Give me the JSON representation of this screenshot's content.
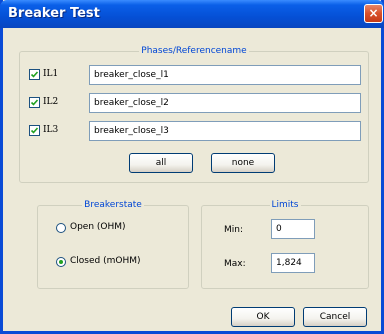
{
  "window": {
    "title": "Breaker Test",
    "close_glyph": "×"
  },
  "phases": {
    "title": "Phases/Referencename",
    "rows": [
      {
        "label": "IL1",
        "checked": true,
        "value": "breaker_close_l1"
      },
      {
        "label": "IL2",
        "checked": true,
        "value": "breaker_close_l2"
      },
      {
        "label": "IL3",
        "checked": true,
        "value": "breaker_close_l3"
      }
    ],
    "all_label": "all",
    "none_label": "none"
  },
  "breakerstate": {
    "title": "Breakerstate",
    "options": [
      {
        "label": "Open (OHM)",
        "selected": false
      },
      {
        "label": "Closed (mOHM)",
        "selected": true
      }
    ]
  },
  "limits": {
    "title": "Limits",
    "min_label": "Min:",
    "min_value": "0",
    "max_label": "Max:",
    "max_value": "1,824"
  },
  "footer": {
    "ok_label": "OK",
    "cancel_label": "Cancel"
  },
  "colors": {
    "title_bar": "#0550d6",
    "group_title": "#0046d5",
    "window_bg": "#ece9d8"
  }
}
